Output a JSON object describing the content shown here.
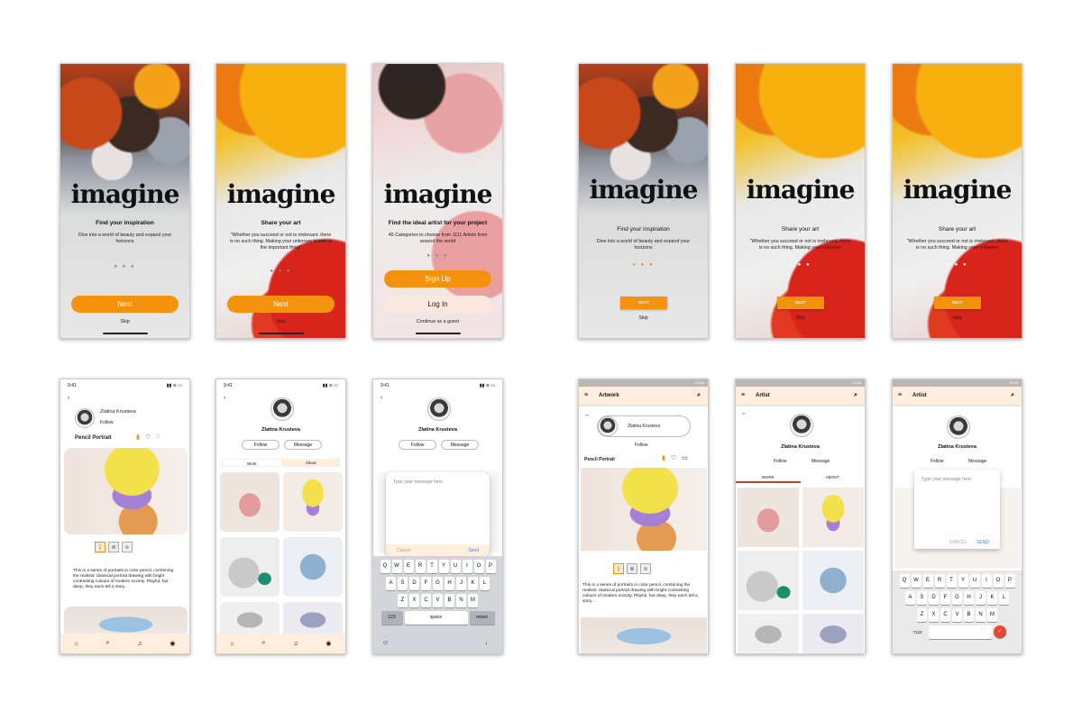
{
  "brand": "imagine",
  "onboarding": [
    {
      "title": "Find your inspiration",
      "desc": "Dive into a world of beauty and expand your horizons",
      "dots": "● ● ●"
    },
    {
      "title": "Share your art",
      "desc": "\"Whether you succeed or not is irrelevant, there is no such thing. Making your unknown known is the important thing\"",
      "dots": "● ● ●"
    },
    {
      "title": "Find the ideal artist for your project",
      "desc": "45 Categories to choose from 1111 Artists from around the world",
      "dots": "● ● ●"
    }
  ],
  "onboarding_android": [
    {
      "title": "Find your inspiration",
      "desc": "Dive into a world of beauty and expand your horizons"
    },
    {
      "title": "Share your art",
      "desc": "\"Whether you succeed or not is irrelevant, there is no such thing. Making your unknown"
    },
    {
      "title": "Share your art",
      "desc": "\"Whether you succeed or not is irrelevant, there is no such thing. Making your unknown"
    }
  ],
  "buttons": {
    "next": "Next",
    "next_upper": "NEXT",
    "skip": "Skip",
    "signup": "Sign Up",
    "login": "Log In",
    "guest": "Continue as a guest"
  },
  "ios_time": "9:41",
  "android_time": "12:30",
  "artist": {
    "name": "Zlatina Krusteva",
    "follow": "Follow",
    "message": "Message"
  },
  "artwork": {
    "title": "Pencil Portrait",
    "text": "This is a series of portraits in color pencil, combining the realistic classical portrait drawing with  bright contrasting colours of modern society. Playful, but deep, they each tell a story..."
  },
  "tabs": {
    "work": "Work",
    "about": "About",
    "work_upper": "WORK",
    "about_upper": "ABOUT"
  },
  "appbar": {
    "artwork": "Artwork",
    "artist": "Artist"
  },
  "dialog": {
    "placeholder": "Type your message here",
    "cancel": "Cancel",
    "send": "Send",
    "cancel_upper": "CANCEL",
    "send_upper": "SEND"
  },
  "keyboard": {
    "row1": [
      "Q",
      "W",
      "E",
      "R",
      "T",
      "Y",
      "U",
      "I",
      "O",
      "P"
    ],
    "row2": [
      "A",
      "S",
      "D",
      "F",
      "G",
      "H",
      "J",
      "K",
      "L"
    ],
    "row3": [
      "Z",
      "X",
      "C",
      "V",
      "B",
      "N",
      "M"
    ],
    "k123": "123",
    "space": "space",
    "return": "return",
    "a123": "?123"
  },
  "icons": {
    "home": "home-icon",
    "search": "search-icon",
    "bell": "bell-icon",
    "profile": "profile-icon",
    "bookmark": "bookmark-icon",
    "heart": "heart-icon",
    "comment": "comment-icon"
  },
  "colors": {
    "accent": "#f5920d",
    "tint": "#fdeede"
  }
}
